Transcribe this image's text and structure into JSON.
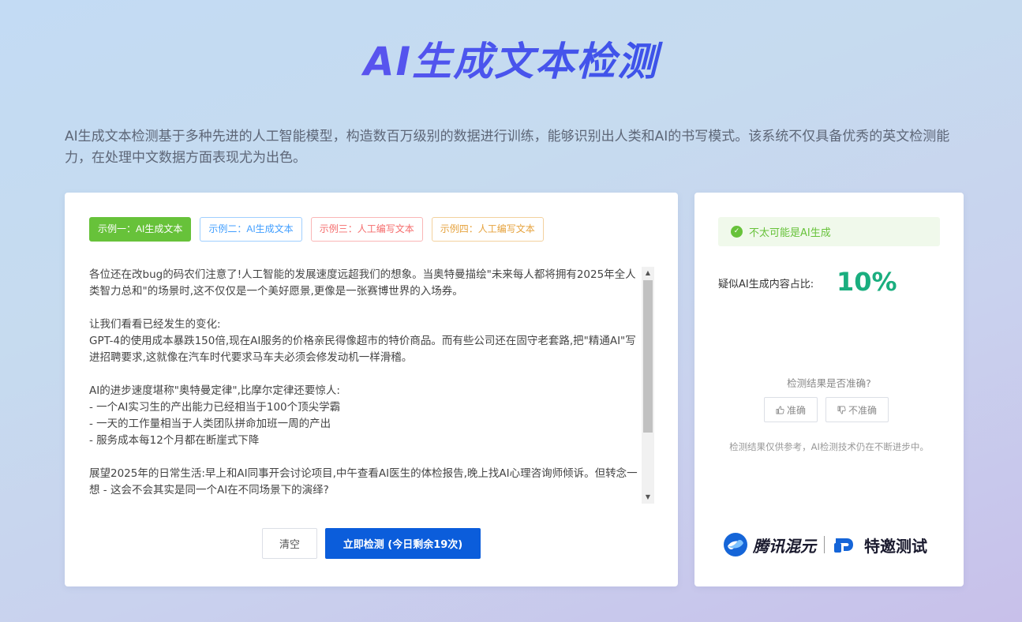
{
  "page": {
    "title": "AI生成文本检测",
    "description": "AI生成文本检测基于多种先进的人工智能模型，构造数百万级别的数据进行训练，能够识别出人类和AI的书写模式。该系统不仅具备优秀的英文检测能力，在处理中文数据方面表现尤为出色。"
  },
  "examples": [
    {
      "label": "示例一：AI生成文本"
    },
    {
      "label": "示例二：AI生成文本"
    },
    {
      "label": "示例三：人工编写文本"
    },
    {
      "label": "示例四：人工编写文本"
    }
  ],
  "editor": {
    "text": "各位还在改bug的码农们注意了!人工智能的发展速度远超我们的想象。当奥特曼描绘\"未来每人都将拥有2025年全人类智力总和\"的场景时,这不仅仅是一个美好愿景,更像是一张赛博世界的入场券。\n\n让我们看看已经发生的变化:\nGPT-4的使用成本暴跌150倍,现在AI服务的价格亲民得像超市的特价商品。而有些公司还在固守老套路,把\"精通AI\"写进招聘要求,这就像在汽车时代要求马车夫必须会修发动机一样滑稽。\n\nAI的进步速度堪称\"奥特曼定律\",比摩尔定律还要惊人:\n- 一个AI实习生的产出能力已经相当于100个顶尖学霸\n- 一天的工作量相当于人类团队拼命加班一周的产出\n- 服务成本每12个月都在断崖式下降\n\n展望2025年的日常生活:早上和AI同事开会讨论项目,中午查看AI医生的体检报告,晚上找AI心理咨询师倾诉。但转念一想 - 这会不会其实是同一个AI在不同场景下的演绎?"
  },
  "actions": {
    "clear_label": "清空",
    "detect_label": "立即检测 (今日剩余19次)"
  },
  "result": {
    "status_text": "不太可能是AI生成",
    "ratio_label": "疑似AI生成内容占比:",
    "ratio_value": "10%",
    "feedback_question": "检测结果是否准确?",
    "accurate_label": "准确",
    "inaccurate_label": "不准确",
    "note": "检测结果仅供参考，AI检测技术仍在不断进步中。"
  },
  "brand": {
    "name1": "腾讯混元",
    "name2": "特邀测试"
  },
  "colors": {
    "accent": "#0b5ddb",
    "success": "#67c23a",
    "ratio": "#1aae7f"
  }
}
